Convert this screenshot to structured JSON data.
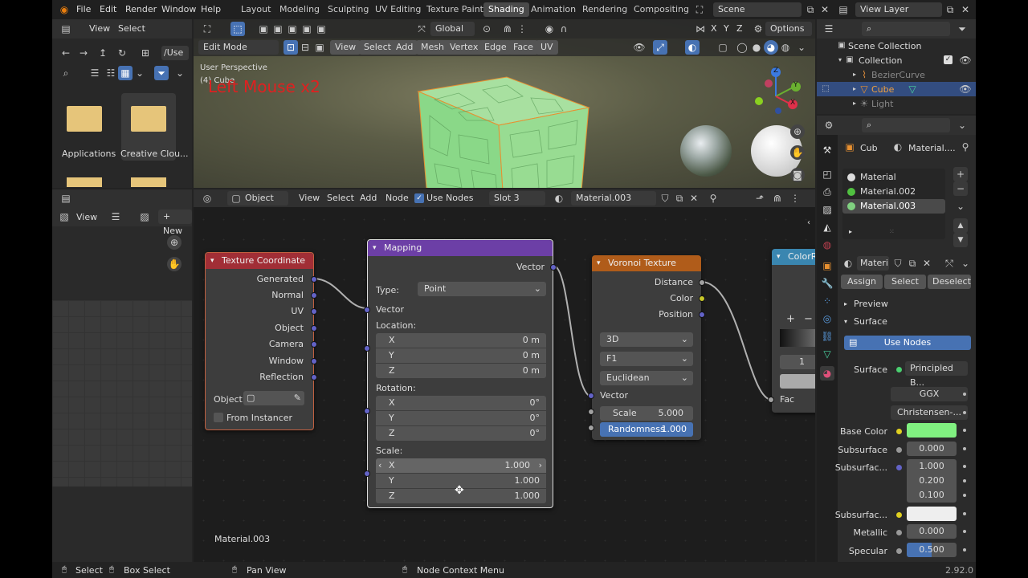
{
  "topbar": {
    "menus": [
      "File",
      "Edit",
      "Render",
      "Window",
      "Help"
    ],
    "workspaces": [
      "Layout",
      "Modeling",
      "Sculpting",
      "UV Editing",
      "Texture Paint",
      "Shading",
      "Animation",
      "Rendering",
      "Compositing"
    ],
    "active_workspace": "Shading",
    "scene": "Scene",
    "view_layer": "View Layer"
  },
  "file_browser": {
    "menus": [
      "View",
      "Select"
    ],
    "path": "/Use",
    "folders": [
      "Applications",
      "Creative Clou..."
    ]
  },
  "viewport": {
    "mode": "Edit Mode",
    "menus": [
      "View",
      "Select",
      "Add",
      "Mesh",
      "Vertex",
      "Edge",
      "Face",
      "UV"
    ],
    "transform": "Global",
    "options": "Options",
    "axes_lock": [
      "X",
      "Y",
      "Z"
    ],
    "overlay_title": "User Perspective",
    "overlay_object": "(4) Cube",
    "screencast_text": "Left Mouse x2",
    "gizmo_axes": [
      "Z",
      "Y",
      "X"
    ]
  },
  "node_editor": {
    "type": "Object",
    "menus": [
      "View",
      "Select",
      "Add",
      "Node"
    ],
    "use_nodes_label": "Use Nodes",
    "slot": "Slot 3",
    "material": "Material.003",
    "footer_material": "Material.003"
  },
  "left_panel": {
    "view_label": "View",
    "new_label": "New"
  },
  "nodes": {
    "texcoord": {
      "title": "Texture Coordinate",
      "outputs": [
        "Generated",
        "Normal",
        "UV",
        "Object",
        "Camera",
        "Window",
        "Reflection"
      ],
      "object_label": "Object:",
      "from_instancer": "From Instancer"
    },
    "mapping": {
      "title": "Mapping",
      "output": "Vector",
      "type_label": "Type:",
      "type_value": "Point",
      "input": "Vector",
      "location_label": "Location:",
      "location": [
        {
          "axis": "X",
          "value": "0 m"
        },
        {
          "axis": "Y",
          "value": "0 m"
        },
        {
          "axis": "Z",
          "value": "0 m"
        }
      ],
      "rotation_label": "Rotation:",
      "rotation": [
        {
          "axis": "X",
          "value": "0°"
        },
        {
          "axis": "Y",
          "value": "0°"
        },
        {
          "axis": "Z",
          "value": "0°"
        }
      ],
      "scale_label": "Scale:",
      "scale": [
        {
          "axis": "X",
          "value": "1.000"
        },
        {
          "axis": "Y",
          "value": "1.000"
        },
        {
          "axis": "Z",
          "value": "1.000"
        }
      ]
    },
    "voronoi": {
      "title": "Voronoi Texture",
      "outputs": [
        "Distance",
        "Color",
        "Position"
      ],
      "dims": "3D",
      "feature": "F1",
      "metric": "Euclidean",
      "input": "Vector",
      "scale_label": "Scale",
      "scale_value": "5.000",
      "randomness_label": "Randomness",
      "randomness_value": "1.000"
    },
    "colorramp": {
      "title": "ColorRa",
      "stop_index": "1",
      "input": "Fac"
    }
  },
  "outliner": {
    "items": [
      {
        "label": "Scene Collection"
      },
      {
        "label": "Collection"
      },
      {
        "label": "BezierCurve"
      },
      {
        "label": "Cube"
      },
      {
        "label": "Light"
      }
    ]
  },
  "properties": {
    "breadcrumb_object": "Cub",
    "breadcrumb_material": "Material....",
    "slots": [
      "Material",
      "Material.002",
      "Material.003"
    ],
    "material_name": "Materi",
    "assign": "Assign",
    "select": "Select",
    "deselect": "Deselect",
    "preview": "Preview",
    "surface_panel": "Surface",
    "use_nodes": "Use Nodes",
    "surface_label": "Surface",
    "surface_value": "Principled B...",
    "distribution": "GGX",
    "subsurface_method": "Christensen-...",
    "rows": [
      {
        "label": "Base Color",
        "value": ""
      },
      {
        "label": "Subsurface",
        "value": "0.000"
      },
      {
        "label": "Subsurfac...",
        "value": "1.000"
      },
      {
        "label": "",
        "value": "0.200"
      },
      {
        "label": "",
        "value": "0.100"
      },
      {
        "label": "Subsurfac...",
        "value": ""
      },
      {
        "label": "Metallic",
        "value": "0.000"
      },
      {
        "label": "Specular",
        "value": "0.500"
      }
    ],
    "specular_fraction": 0.5
  },
  "statusbar": {
    "select": "Select",
    "box_select": "Box Select",
    "pan_view": "Pan View",
    "context_menu": "Node Context Menu",
    "version": "2.92.0"
  },
  "colors": {
    "accent_blue": "#4772b3",
    "texcoord_header": "#a12e36",
    "mapping_header": "#6c3fa6",
    "voronoi_header": "#b05c1a",
    "colorramp_header": "#3a86b0",
    "base_color": "#80f080"
  }
}
